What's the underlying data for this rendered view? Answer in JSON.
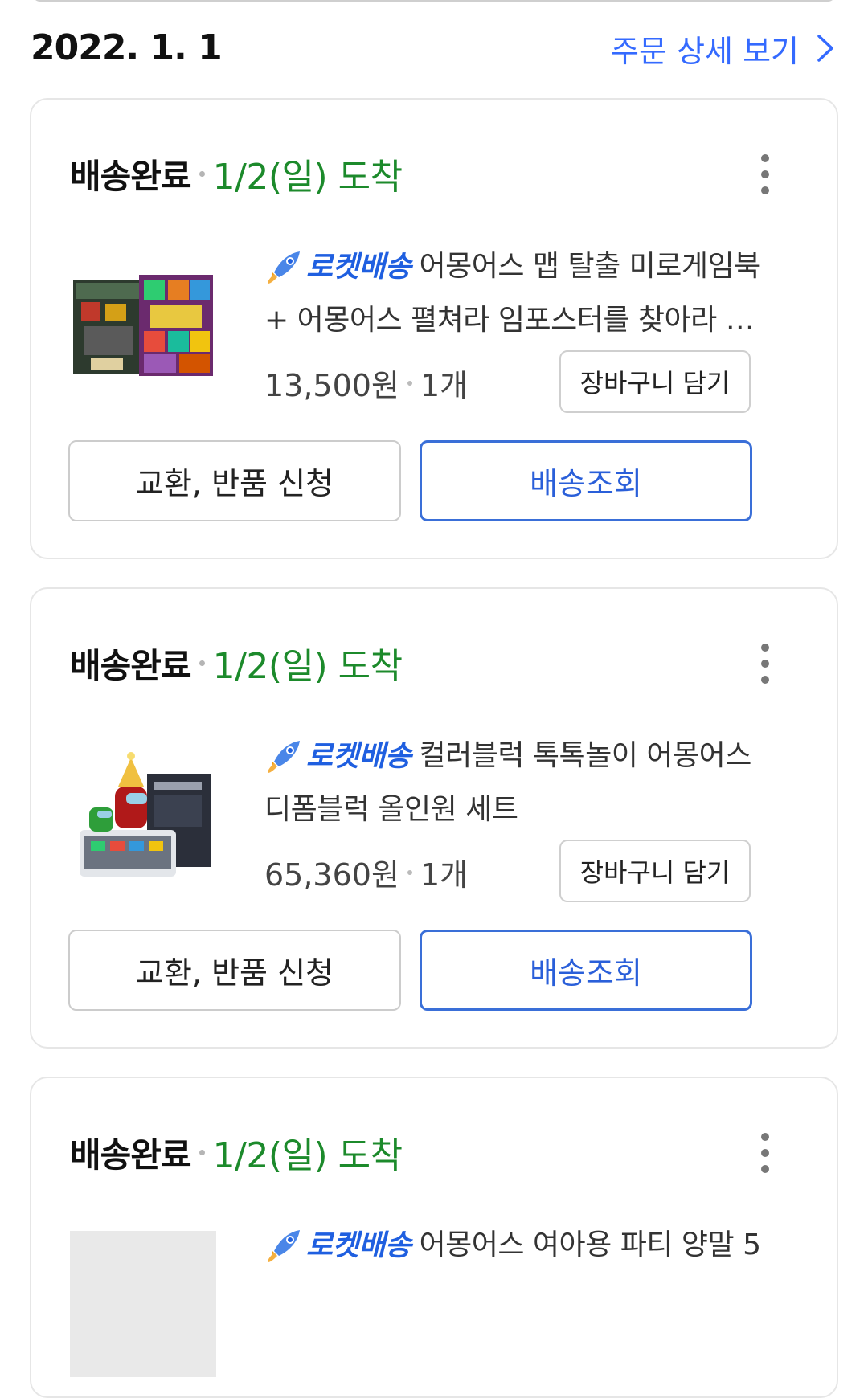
{
  "header": {
    "order_date": "2022. 1. 1",
    "detail_link_label": "주문 상세 보기"
  },
  "orders": [
    {
      "status": "배송완료",
      "arrival": "1/2(일) 도착",
      "rocket_label": "로켓배송",
      "title": "어몽어스 맵 탈출 미로게임북 + 어몽어스 펼쳐라 임포스터를 찾아라 어몽어스 책",
      "price": "13,500원",
      "quantity": "1개",
      "cart_label": "장바구니 담기",
      "return_label": "교환, 반품 신청",
      "track_label": "배송조회"
    },
    {
      "status": "배송완료",
      "arrival": "1/2(일) 도착",
      "rocket_label": "로켓배송",
      "title": "컬러블럭 톡톡놀이 어몽어스 디폼블럭 올인원 세트",
      "price": "65,360원",
      "quantity": "1개",
      "cart_label": "장바구니 담기",
      "return_label": "교환, 반품 신청",
      "track_label": "배송조회"
    },
    {
      "status": "배송완료",
      "arrival": "1/2(일) 도착",
      "rocket_label": "로켓배송",
      "title": "어몽어스 여아용 파티 양말 5"
    }
  ],
  "colors": {
    "link_blue": "#346aff",
    "arrival_green": "#1c8a2b",
    "track_border": "#3a6fd8"
  }
}
